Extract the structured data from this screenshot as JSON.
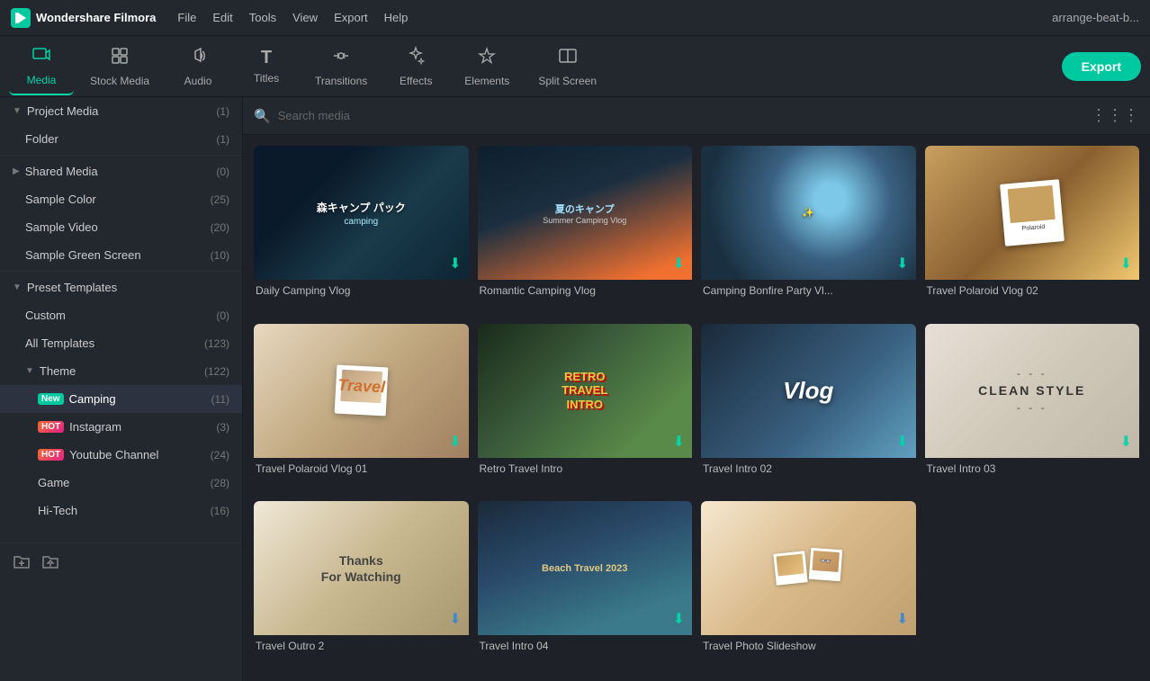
{
  "app": {
    "name": "Wondershare Filmora",
    "user": "arrange-beat-b..."
  },
  "menu": {
    "items": [
      "File",
      "Edit",
      "Tools",
      "View",
      "Export",
      "Help"
    ]
  },
  "toolbar": {
    "items": [
      {
        "id": "media",
        "label": "Media",
        "icon": "🎬",
        "active": true
      },
      {
        "id": "stock-media",
        "label": "Stock Media",
        "icon": "📦",
        "active": false
      },
      {
        "id": "audio",
        "label": "Audio",
        "icon": "🎵",
        "active": false
      },
      {
        "id": "titles",
        "label": "Titles",
        "icon": "T",
        "active": false
      },
      {
        "id": "transitions",
        "label": "Transitions",
        "icon": "↔",
        "active": false
      },
      {
        "id": "effects",
        "label": "Effects",
        "icon": "✨",
        "active": false
      },
      {
        "id": "elements",
        "label": "Elements",
        "icon": "⬡",
        "active": false
      },
      {
        "id": "split-screen",
        "label": "Split Screen",
        "icon": "⊞",
        "active": false
      }
    ],
    "export_label": "Export"
  },
  "sidebar": {
    "sections": [
      {
        "id": "project-media",
        "label": "Project Media",
        "count": 1,
        "expanded": true,
        "indent": 0
      },
      {
        "id": "folder",
        "label": "Folder",
        "count": 1,
        "indent": 1
      },
      {
        "id": "shared-media",
        "label": "Shared Media",
        "count": 0,
        "expanded": false,
        "indent": 0
      },
      {
        "id": "sample-color",
        "label": "Sample Color",
        "count": 25,
        "indent": 1
      },
      {
        "id": "sample-video",
        "label": "Sample Video",
        "count": 20,
        "indent": 1
      },
      {
        "id": "sample-green-screen",
        "label": "Sample Green Screen",
        "count": 10,
        "indent": 1
      },
      {
        "id": "preset-templates",
        "label": "Preset Templates",
        "count": null,
        "expanded": true,
        "indent": 0
      },
      {
        "id": "custom",
        "label": "Custom",
        "count": 0,
        "indent": 1
      },
      {
        "id": "all-templates",
        "label": "All Templates",
        "count": 123,
        "indent": 1
      },
      {
        "id": "theme",
        "label": "Theme",
        "count": 122,
        "expanded": true,
        "indent": 1
      },
      {
        "id": "camping",
        "label": "Camping",
        "count": 11,
        "badge": "new",
        "active": true,
        "indent": 2
      },
      {
        "id": "instagram",
        "label": "Instagram",
        "count": 3,
        "badge": "hot",
        "indent": 2
      },
      {
        "id": "youtube-channel",
        "label": "Youtube Channel",
        "count": 24,
        "badge": "hot",
        "indent": 2
      },
      {
        "id": "game",
        "label": "Game",
        "count": 28,
        "indent": 2
      },
      {
        "id": "hi-tech",
        "label": "Hi-Tech",
        "count": 16,
        "indent": 2
      }
    ]
  },
  "search": {
    "placeholder": "Search media"
  },
  "media_items": [
    {
      "id": "daily-camping",
      "title": "Daily Camping Vlog",
      "thumb": "camping1"
    },
    {
      "id": "romantic-camping",
      "title": "Romantic Camping Vlog",
      "thumb": "camping2"
    },
    {
      "id": "camping-bonfire",
      "title": "Camping Bonfire Party Vl...",
      "thumb": "camping3"
    },
    {
      "id": "travel-polaroid2",
      "title": "Travel Polaroid Vlog 02",
      "thumb": "polaroid2"
    },
    {
      "id": "travel-polaroid1",
      "title": "Travel Polaroid Vlog 01",
      "thumb": "travel-pol1"
    },
    {
      "id": "retro-travel",
      "title": "Retro Travel Intro",
      "thumb": "retro"
    },
    {
      "id": "travel-intro2",
      "title": "Travel Intro 02",
      "thumb": "vlog"
    },
    {
      "id": "travel-intro3",
      "title": "Travel Intro 03",
      "thumb": "clean"
    },
    {
      "id": "travel-outro2",
      "title": "Travel Outro 2",
      "thumb": "outro"
    },
    {
      "id": "travel-intro4",
      "title": "Travel Intro 04",
      "thumb": "intro4"
    },
    {
      "id": "travel-photo-slideshow",
      "title": "Travel Photo Slideshow",
      "thumb": "photo-slideshow"
    }
  ]
}
